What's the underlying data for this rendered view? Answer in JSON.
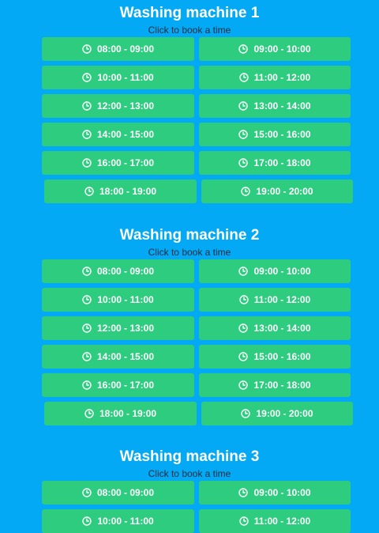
{
  "machines": [
    {
      "title": "Washing machine 1",
      "subtitle": "Click to book a time",
      "slots": [
        "08:00 - 09:00",
        "09:00 - 10:00",
        "10:00 - 11:00",
        "11:00 - 12:00",
        "12:00 - 13:00",
        "13:00 - 14:00",
        "14:00 - 15:00",
        "15:00 - 16:00",
        "16:00 - 17:00",
        "17:00 - 18:00",
        "18:00 - 19:00",
        "19:00 - 20:00"
      ]
    },
    {
      "title": "Washing machine 2",
      "subtitle": "Click to book a time",
      "slots": [
        "08:00 - 09:00",
        "09:00 - 10:00",
        "10:00 - 11:00",
        "11:00 - 12:00",
        "12:00 - 13:00",
        "13:00 - 14:00",
        "14:00 - 15:00",
        "15:00 - 16:00",
        "16:00 - 17:00",
        "17:00 - 18:00",
        "18:00 - 19:00",
        "19:00 - 20:00"
      ]
    },
    {
      "title": "Washing machine 3",
      "subtitle": "Click to book a time",
      "slots": [
        "08:00 - 09:00",
        "09:00 - 10:00",
        "10:00 - 11:00",
        "11:00 - 12:00"
      ]
    }
  ],
  "icons": {
    "slot_icon": "clock-icon"
  },
  "colors": {
    "background": "#03a9f4",
    "slot": "#2ecc7f",
    "title": "#ffffff",
    "subtitle": "#1f2d3d"
  }
}
